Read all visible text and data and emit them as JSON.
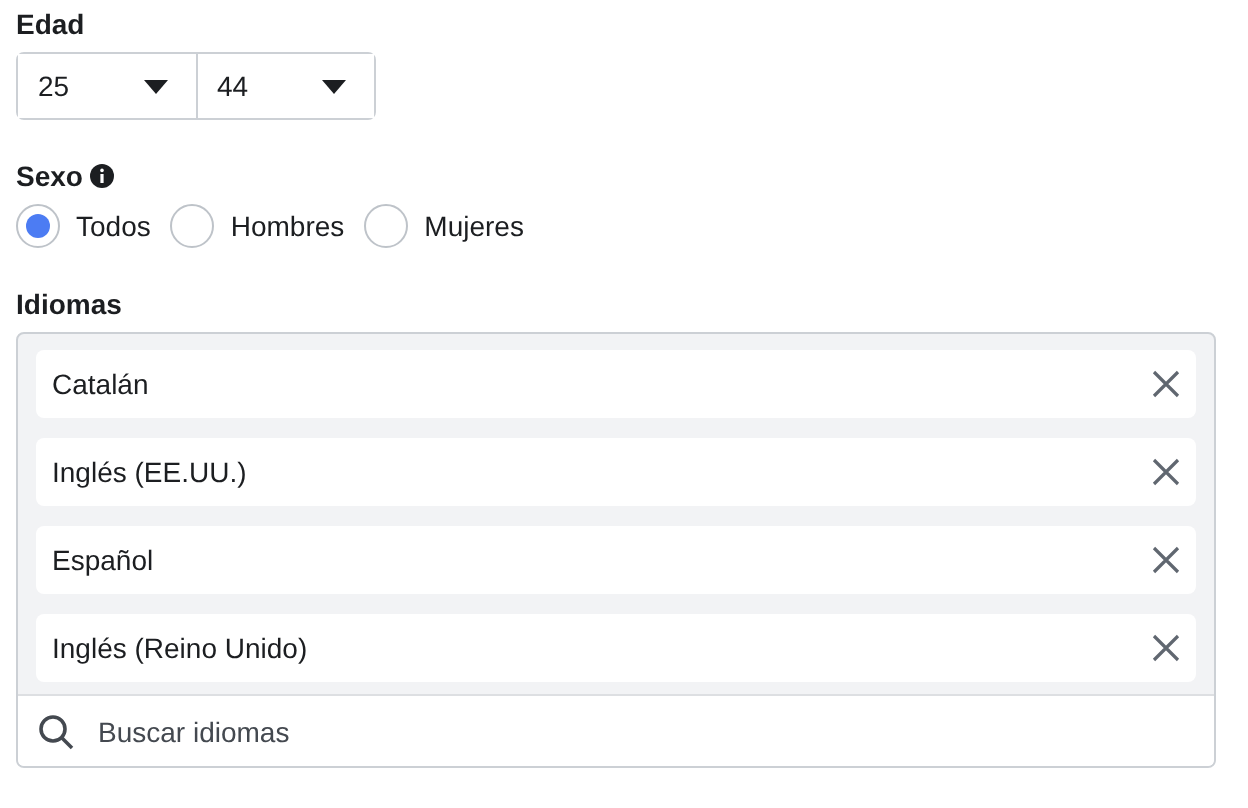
{
  "age": {
    "label": "Edad",
    "from": "25",
    "to": "44"
  },
  "gender": {
    "label": "Sexo",
    "options": [
      {
        "label": "Todos",
        "selected": true
      },
      {
        "label": "Hombres",
        "selected": false
      },
      {
        "label": "Mujeres",
        "selected": false
      }
    ]
  },
  "languages": {
    "label": "Idiomas",
    "items": [
      "Catalán",
      "Inglés (EE.UU.)",
      "Español",
      "Inglés (Reino Unido)"
    ],
    "search": {
      "placeholder": "Buscar idiomas"
    }
  }
}
